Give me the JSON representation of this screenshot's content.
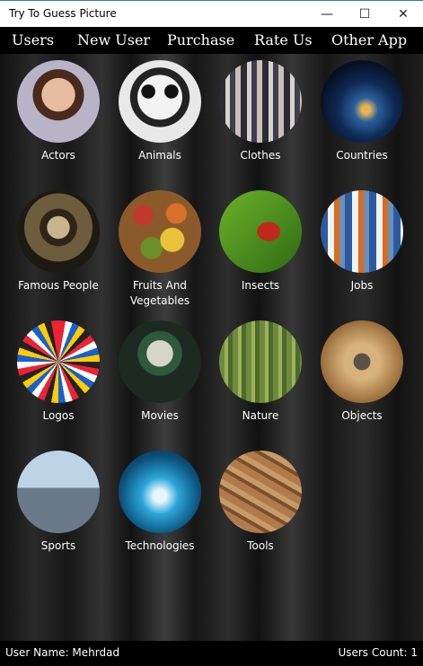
{
  "window": {
    "title": "Try To Guess Picture",
    "minimize_glyph": "—",
    "maximize_glyph": "☐",
    "close_glyph": "✕"
  },
  "menu": [
    "Users",
    "New User",
    "Purchase",
    "Rate Us",
    "Other App"
  ],
  "categories": [
    {
      "label": "Actors",
      "icon": "actress-portrait-icon"
    },
    {
      "label": "Animals",
      "icon": "panda-icon"
    },
    {
      "label": "Clothes",
      "icon": "fashion-models-icon"
    },
    {
      "label": "Countries",
      "icon": "earth-night-icon"
    },
    {
      "label": "Famous People",
      "icon": "lincoln-portrait-icon"
    },
    {
      "label": "Fruits And Vegetables",
      "icon": "fruit-basket-icon"
    },
    {
      "label": "Insects",
      "icon": "ladybug-icon"
    },
    {
      "label": "Jobs",
      "icon": "workers-group-icon"
    },
    {
      "label": "Logos",
      "icon": "logo-collage-icon"
    },
    {
      "label": "Movies",
      "icon": "joker-icon"
    },
    {
      "label": "Nature",
      "icon": "forest-bird-icon"
    },
    {
      "label": "Objects",
      "icon": "decorative-egg-icon"
    },
    {
      "label": "Sports",
      "icon": "athletes-icon"
    },
    {
      "label": "Technologies",
      "icon": "digital-hand-icon"
    },
    {
      "label": "Tools",
      "icon": "tools-icon"
    }
  ],
  "status": {
    "user_name": "User Name: Mehrdad",
    "users_count": "Users Count: 1"
  }
}
